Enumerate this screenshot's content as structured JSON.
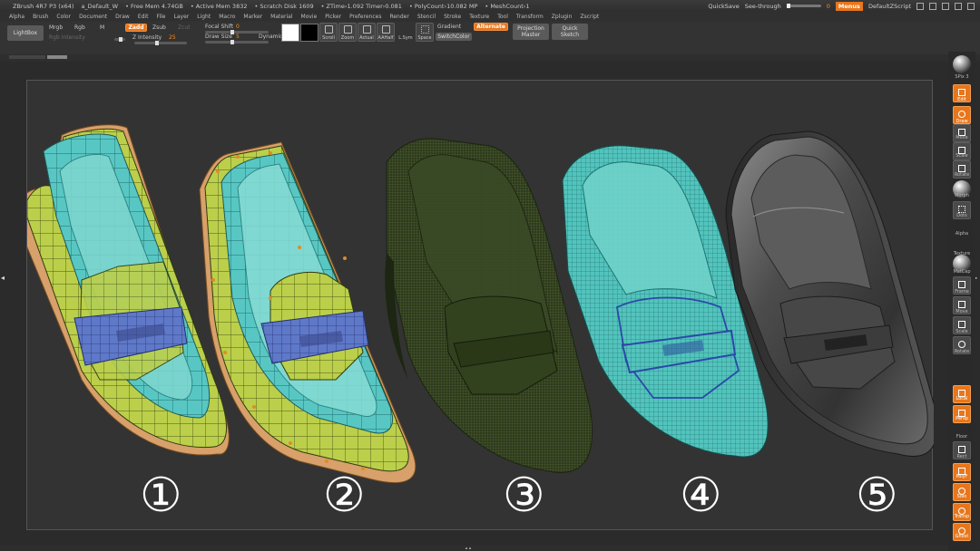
{
  "titlebar": {
    "items": [
      "ZBrush 4R7 P3 (x64)",
      "a_Default_W",
      "• Free Mem 4.74GB",
      "• Active Mem 3832",
      "• Scratch Disk 1609",
      "• ZTime›1.092 Timer›0.081",
      "• PolyCount›10.082 MP",
      "• MeshCount›1"
    ],
    "quicksave": "QuickSave",
    "see_through_label": "See-through",
    "see_through_value": "0",
    "menus": "Menus",
    "script": "DefaultZScript"
  },
  "menubar": {
    "items": [
      "Alpha",
      "Brush",
      "Color",
      "Document",
      "Draw",
      "Edit",
      "File",
      "Layer",
      "Light",
      "Macro",
      "Marker",
      "Material",
      "Movie",
      "Picker",
      "Preferences",
      "Render",
      "Stencil",
      "Stroke",
      "Texture",
      "Tool",
      "Transform",
      "Zplugin",
      "Zscript"
    ]
  },
  "shelf": {
    "lightbox": "LightBox",
    "mrgb": "Mrgb",
    "rgb": "Rgb",
    "m": "M",
    "zadd": "Zadd",
    "zsub": "Zsub",
    "zcut": "Zcut",
    "rgb_intensity": "Rgb Intensity",
    "z_intensity_label": "Z Intensity",
    "z_intensity_value": "25",
    "focal_shift_label": "Focal Shift",
    "focal_shift_value": "0",
    "draw_size_label": "Draw Size",
    "draw_size_value": "5",
    "dynamic": "Dynamic",
    "tools": [
      "Scroll",
      "Zoom",
      "Actual",
      "AAHalf"
    ],
    "lsym": "L.Sym",
    "xyz": "·X·Y·Z",
    "space": "Space",
    "gradient": "Gradient",
    "switchcolor": "SwitchColor",
    "alternate": "Alternate",
    "projection_master": "Projection Master",
    "quick_sketch": "Quick Sketch"
  },
  "stages": [
    {
      "number": "①"
    },
    {
      "number": "②"
    },
    {
      "number": "③"
    },
    {
      "number": "④"
    },
    {
      "number": "⑤"
    }
  ],
  "righttray": {
    "spix": "SPix 3",
    "buttons": [
      "Edit",
      "Draw",
      "Move",
      "Scale",
      "Rotate",
      "Morph",
      "Dots",
      "Alpha",
      "Texture",
      "MatCap",
      "Frame",
      "Move",
      "Scale",
      "Rotate",
      "Local",
      "Persp",
      "Floor",
      "Rect",
      "PolyF",
      "Solo",
      "Transp",
      "Ghost"
    ]
  },
  "colors": {
    "accent": "#e8761c",
    "mesh_stage1": "#c0d14a",
    "mesh_teal": "#4fc4c4",
    "strap_blue": "#5a75c8",
    "sole": "#d7a06b",
    "dark_green": "#2c3b1f",
    "gray_final": "#4a4a4a"
  }
}
